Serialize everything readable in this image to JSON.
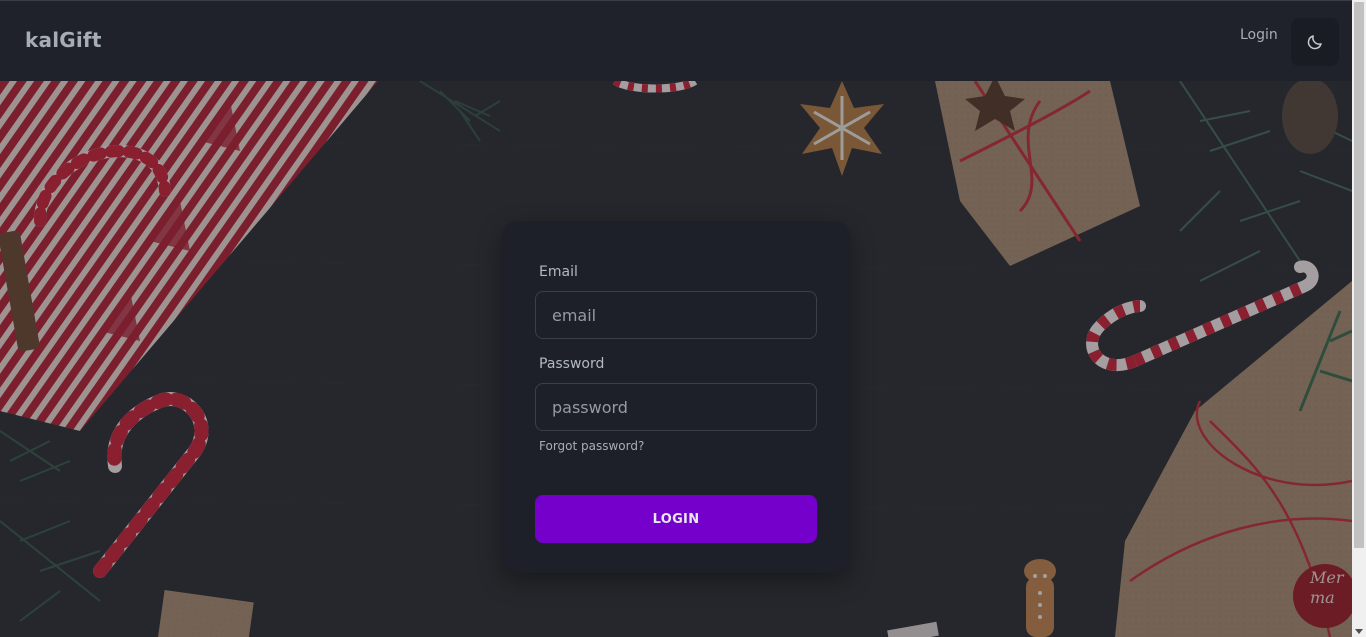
{
  "navbar": {
    "brand": "kalGift",
    "login_link": "Login",
    "theme_toggle_icon": "moon-icon"
  },
  "login_form": {
    "email_label": "Email",
    "email_placeholder": "email",
    "password_label": "Password",
    "password_placeholder": "password",
    "forgot_password": "Forgot password?",
    "submit_label": "LOGIN"
  },
  "colors": {
    "accent": "#7500cc",
    "background": "#1d2028",
    "text": "#a7adb7"
  }
}
